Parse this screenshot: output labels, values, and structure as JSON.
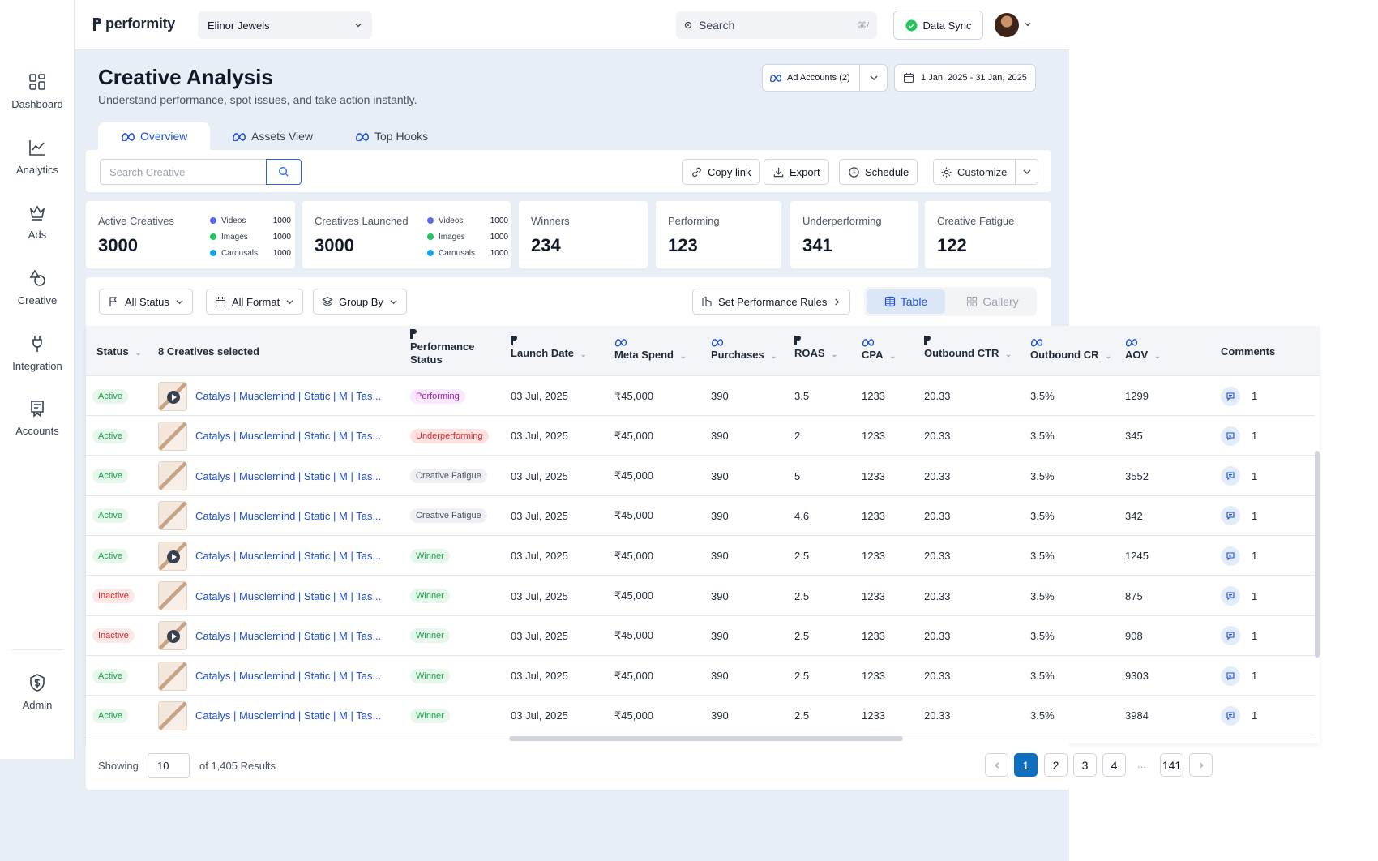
{
  "brand": {
    "name": "performity"
  },
  "account_select": {
    "value": "Elinor Jewels"
  },
  "top_search": {
    "placeholder": "Search",
    "shortcut": "⌘/"
  },
  "data_sync": {
    "label": "Data Sync"
  },
  "sidebar": {
    "items": [
      {
        "label": "Dashboard",
        "icon": "grid-icon"
      },
      {
        "label": "Analytics",
        "icon": "chart-line-icon"
      },
      {
        "label": "Ads",
        "icon": "crown-icon"
      },
      {
        "label": "Creative",
        "icon": "shapes-icon"
      },
      {
        "label": "Integration",
        "icon": "plug-icon"
      },
      {
        "label": "Accounts",
        "icon": "receipt-icon"
      }
    ],
    "admin": {
      "label": "Admin",
      "icon": "dollar-shield-icon"
    }
  },
  "header": {
    "title": "Creative Analysis",
    "subtitle": "Understand performance, spot issues, and take action instantly.",
    "ad_accounts": "Ad Accounts (2)",
    "date_range": "1 Jan, 2025 - 31 Jan, 2025"
  },
  "tabs": [
    {
      "label": "Overview"
    },
    {
      "label": "Assets View"
    },
    {
      "label": "Top Hooks"
    }
  ],
  "toolbar": {
    "search_placeholder": "Search Creative",
    "copy_link": "Copy link",
    "export": "Export",
    "schedule": "Schedule",
    "customize": "Customize"
  },
  "stats": {
    "active": {
      "title": "Active Creatives",
      "value": "3000",
      "breakdown": [
        {
          "label": "Videos",
          "value": "1000",
          "color": "#6366f1"
        },
        {
          "label": "Images",
          "value": "1000",
          "color": "#22c55e"
        },
        {
          "label": "Carousals",
          "value": "1000",
          "color": "#0ea5e9"
        }
      ]
    },
    "launched": {
      "title": "Creatives Launched",
      "value": "3000",
      "breakdown": [
        {
          "label": "Videos",
          "value": "1000",
          "color": "#6366f1"
        },
        {
          "label": "Images",
          "value": "1000",
          "color": "#22c55e"
        },
        {
          "label": "Carousals",
          "value": "1000",
          "color": "#0ea5e9"
        }
      ]
    },
    "winners": {
      "title": "Winners",
      "value": "234"
    },
    "performing": {
      "title": "Performing",
      "value": "123"
    },
    "underperforming": {
      "title": "Underperforming",
      "value": "341"
    },
    "fatigue": {
      "title": "Creative Fatigue",
      "value": "122"
    }
  },
  "filters": {
    "status": "All Status",
    "format": "All Format",
    "group_by": "Group By",
    "rules": "Set Performance Rules",
    "view_table": "Table",
    "view_gallery": "Gallery"
  },
  "table": {
    "columns": {
      "status": "Status",
      "selected": "8 Creatives selected",
      "perf_status": "Performance Status",
      "launch_date": "Launch Date",
      "meta_spend": "Meta Spend",
      "purchases": "Purchases",
      "roas": "ROAS",
      "cpa": "CPA",
      "outbound_ctr": "Outbound CTR",
      "outbound_cr": "Outbound CR",
      "aov": "AOV",
      "comments": "Comments"
    },
    "rows": [
      {
        "status": "Active",
        "video": true,
        "name": "Catalys | Musclemind | Static | M | Tas...",
        "perf": "Performing",
        "date": "03 Jul, 2025",
        "spend": "₹45,000",
        "purchases": "390",
        "roas": "3.5",
        "cpa": "1233",
        "ctr": "20.33",
        "cr": "3.5%",
        "aov": "1299",
        "comments": "1"
      },
      {
        "status": "Active",
        "video": false,
        "name": "Catalys | Musclemind | Static | M | Tas...",
        "perf": "Underperforming",
        "date": "03 Jul, 2025",
        "spend": "₹45,000",
        "purchases": "390",
        "roas": "2",
        "cpa": "1233",
        "ctr": "20.33",
        "cr": "3.5%",
        "aov": "345",
        "comments": "1"
      },
      {
        "status": "Active",
        "video": false,
        "name": "Catalys | Musclemind | Static | M | Tas...",
        "perf": "Creative Fatigue",
        "date": "03 Jul, 2025",
        "spend": "₹45,000",
        "purchases": "390",
        "roas": "5",
        "cpa": "1233",
        "ctr": "20.33",
        "cr": "3.5%",
        "aov": "3552",
        "comments": "1"
      },
      {
        "status": "Active",
        "video": false,
        "name": "Catalys | Musclemind | Static | M | Tas...",
        "perf": "Creative Fatigue",
        "date": "03 Jul, 2025",
        "spend": "₹45,000",
        "purchases": "390",
        "roas": "4.6",
        "cpa": "1233",
        "ctr": "20.33",
        "cr": "3.5%",
        "aov": "342",
        "comments": "1"
      },
      {
        "status": "Active",
        "video": true,
        "name": "Catalys | Musclemind | Static | M | Tas...",
        "perf": "Winner",
        "date": "03 Jul, 2025",
        "spend": "₹45,000",
        "purchases": "390",
        "roas": "2.5",
        "cpa": "1233",
        "ctr": "20.33",
        "cr": "3.5%",
        "aov": "1245",
        "comments": "1"
      },
      {
        "status": "Inactive",
        "video": false,
        "name": "Catalys | Musclemind | Static | M | Tas...",
        "perf": "Winner",
        "date": "03 Jul, 2025",
        "spend": "₹45,000",
        "purchases": "390",
        "roas": "2.5",
        "cpa": "1233",
        "ctr": "20.33",
        "cr": "3.5%",
        "aov": "875",
        "comments": "1"
      },
      {
        "status": "Inactive",
        "video": true,
        "name": "Catalys | Musclemind | Static | M | Tas...",
        "perf": "Winner",
        "date": "03 Jul, 2025",
        "spend": "₹45,000",
        "purchases": "390",
        "roas": "2.5",
        "cpa": "1233",
        "ctr": "20.33",
        "cr": "3.5%",
        "aov": "908",
        "comments": "1"
      },
      {
        "status": "Active",
        "video": false,
        "name": "Catalys | Musclemind | Static | M | Tas...",
        "perf": "Winner",
        "date": "03 Jul, 2025",
        "spend": "₹45,000",
        "purchases": "390",
        "roas": "2.5",
        "cpa": "1233",
        "ctr": "20.33",
        "cr": "3.5%",
        "aov": "9303",
        "comments": "1"
      },
      {
        "status": "Active",
        "video": false,
        "name": "Catalys | Musclemind | Static | M | Tas...",
        "perf": "Winner",
        "date": "03 Jul, 2025",
        "spend": "₹45,000",
        "purchases": "390",
        "roas": "2.5",
        "cpa": "1233",
        "ctr": "20.33",
        "cr": "3.5%",
        "aov": "3984",
        "comments": "1"
      }
    ]
  },
  "pagination": {
    "showing_label": "Showing",
    "page_size": "10",
    "results": "of 1,405 Results",
    "pages": [
      "1",
      "2",
      "3",
      "4"
    ],
    "ellipsis": "...",
    "last": "141",
    "current": "1"
  },
  "colors": {
    "accent": "#1d4ed8",
    "page_active": "#0f6fbf",
    "active": "#16a34a",
    "inactive": "#dc2626"
  }
}
